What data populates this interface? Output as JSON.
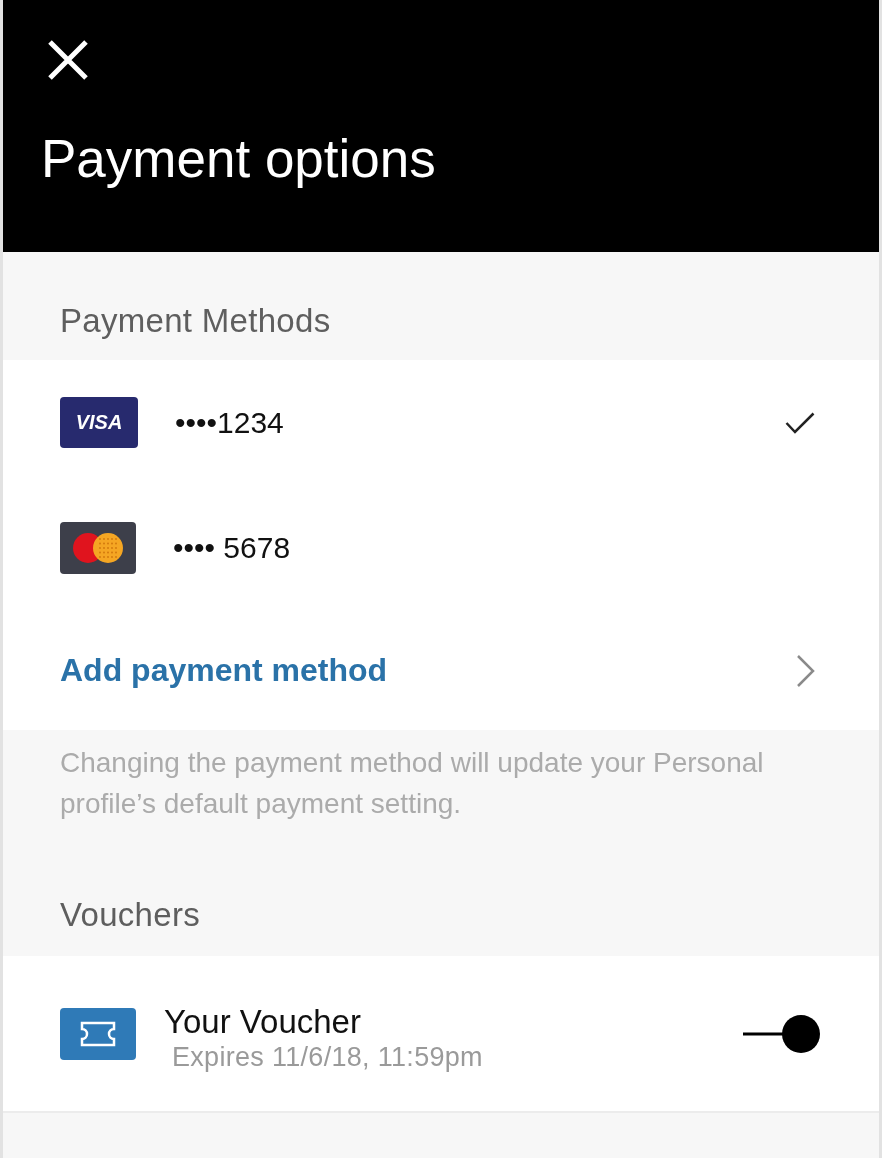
{
  "header": {
    "title": "Payment options"
  },
  "payment_methods": {
    "heading": "Payment Methods",
    "cards": [
      {
        "kind": "visa",
        "logo_text": "VISA",
        "number": "••••1234",
        "selected": true
      },
      {
        "kind": "mastercard",
        "number": "•••• 5678",
        "selected": false
      }
    ],
    "add_action": {
      "label": "Add payment method"
    },
    "note": "Changing the payment method will update your Personal profile’s default payment setting."
  },
  "vouchers": {
    "heading": "Vouchers",
    "items": [
      {
        "title": "Your Voucher",
        "subtitle": "Expires 11/6/18, 11:59pm",
        "on": true
      }
    ]
  }
}
